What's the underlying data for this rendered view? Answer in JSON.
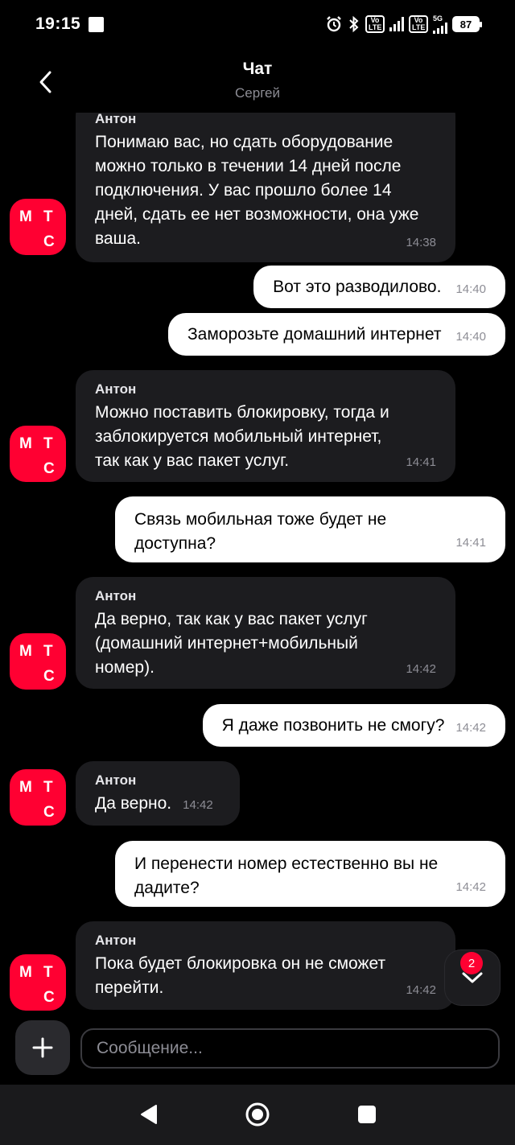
{
  "status_bar": {
    "time": "19:15",
    "volte1_top": "Vo",
    "volte1_bottom": "LTE",
    "volte2_top": "Vo",
    "volte2_bottom": "LTE",
    "network": "5G",
    "battery": "87"
  },
  "header": {
    "title": "Чат",
    "subtitle": "Сергей"
  },
  "avatar": {
    "l1": "М",
    "l2": "Т",
    "l3": "С",
    "brand_color": "#ff0032"
  },
  "messages": [
    {
      "sender": "Антон",
      "text": "Понимаю вас, но сдать оборудование можно только в течении 14 дней после подключения. У вас прошло более 14 дней, сдать ее нет возможности, она уже ваша.",
      "time": "14:38"
    },
    {
      "text": "Вот это разводилово.",
      "time": "14:40"
    },
    {
      "text": "Заморозьте домашний интернет",
      "time": "14:40"
    },
    {
      "sender": "Антон",
      "text": "Можно поставить блокировку, тогда и заблокируется мобильный интернет, так как у вас пакет услуг.",
      "time": "14:41"
    },
    {
      "text": "Связь мобильная тоже будет не доступна?",
      "time": "14:41"
    },
    {
      "sender": "Антон",
      "text": "Да верно, так как у вас пакет услуг (домашний интернет+мобильный номер).",
      "time": "14:42"
    },
    {
      "text": "Я даже позвонить не смогу?",
      "time": "14:42"
    },
    {
      "sender": "Антон",
      "text": "Да верно.",
      "time": "14:42"
    },
    {
      "text": "И перенести номер естественно вы не дадите?",
      "time": "14:42"
    },
    {
      "sender": "Антон",
      "text": "Пока будет блокировка он не сможет перейти.",
      "time": "14:42"
    }
  ],
  "scroll_down": {
    "badge": "2"
  },
  "input": {
    "placeholder": "Сообщение..."
  },
  "icons": {
    "back": "chevron-left-icon",
    "add": "plus-icon",
    "scroll": "chevron-down-icon",
    "nav_back": "triangle-back-icon",
    "nav_home": "circle-home-icon",
    "nav_recents": "square-recents-icon"
  }
}
